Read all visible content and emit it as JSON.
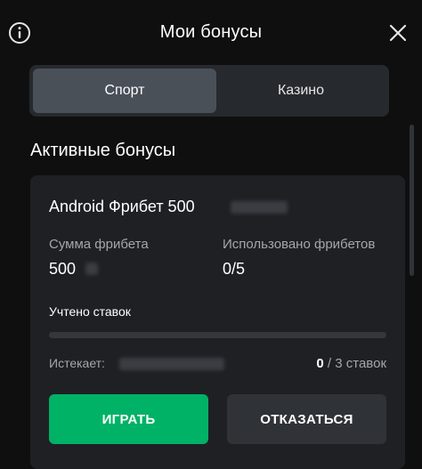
{
  "header": {
    "title": "Мои бонусы",
    "info_icon": "info-circle-icon",
    "close_icon": "close-icon"
  },
  "tabs": [
    {
      "label": "Спорт",
      "active": true
    },
    {
      "label": "Казино",
      "active": false
    }
  ],
  "section_title": "Активные бонусы",
  "bonus": {
    "title": "Android Фрибет 500",
    "amount_label": "Сумма фрибета",
    "amount_value": "500",
    "used_label": "Использовано фрибетов",
    "used_value": "0/5",
    "counted_label": "Учтено ставок",
    "progress": 0,
    "expires_label": "Истекает:",
    "bets_current": "0",
    "bets_suffix": "/ 3 ставок",
    "play_label": "ИГРАТЬ",
    "decline_label": "ОТКАЗАТЬСЯ"
  },
  "colors": {
    "background": "#0f0f0f",
    "card": "#1e2024",
    "accent_green": "#00b266",
    "tab_active": "#4a5058"
  }
}
